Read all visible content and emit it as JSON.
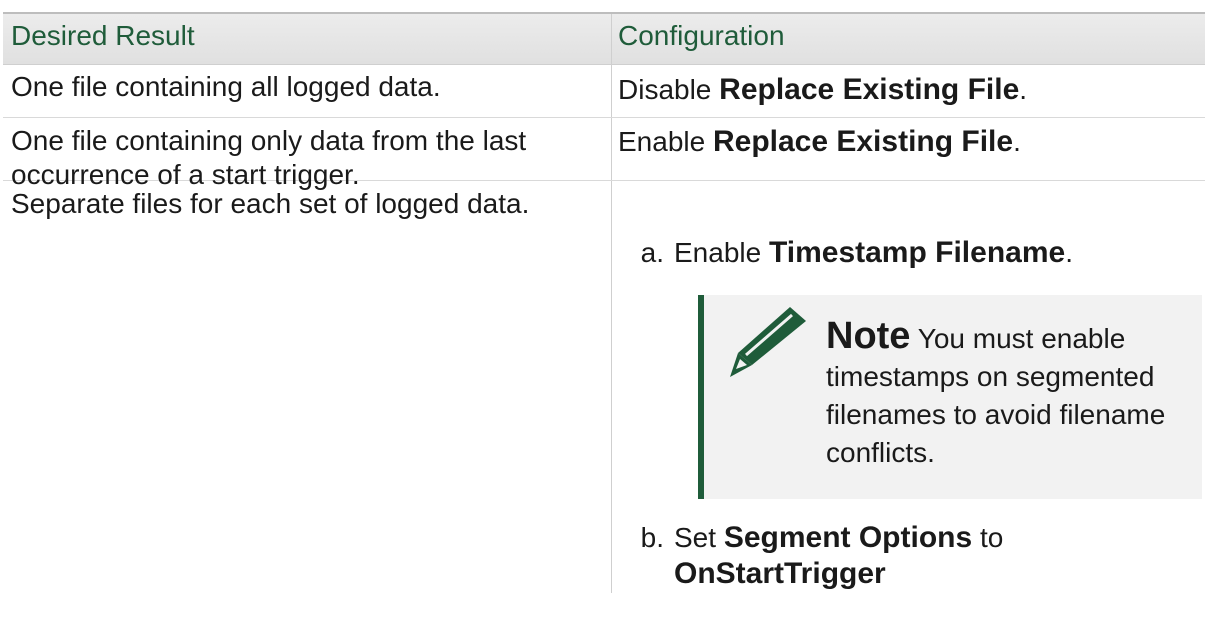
{
  "table": {
    "headers": [
      "Desired Result",
      "Configuration"
    ],
    "rows": [
      {
        "result": "One file containing all logged data.",
        "config_prefix": "Disable ",
        "config_strong": "Replace Existing File",
        "config_suffix": "."
      },
      {
        "result": "One file containing only data from the last occurrence of a start trigger.",
        "config_prefix": "Enable ",
        "config_strong": "Replace Existing File",
        "config_suffix": "."
      },
      {
        "result": "Separate files for each set of logged data.",
        "steps": [
          {
            "marker": "a.",
            "prefix": "Enable ",
            "strong": "Timestamp Filename",
            "suffix": "."
          },
          {
            "marker": "b.",
            "prefix": "Set ",
            "strong": "Segment Options",
            "middle": " to ",
            "strong2": "OnStartTrigger"
          }
        ],
        "note": {
          "label": "Note",
          "text": " You must enable timestamps on segmented filenames to avoid filename conflicts."
        }
      }
    ]
  },
  "colors": {
    "header_text": "#1f5c3a",
    "note_bar": "#1f5c3a",
    "note_bg": "#f2f2f2"
  },
  "icons": [
    "pencil-icon"
  ]
}
